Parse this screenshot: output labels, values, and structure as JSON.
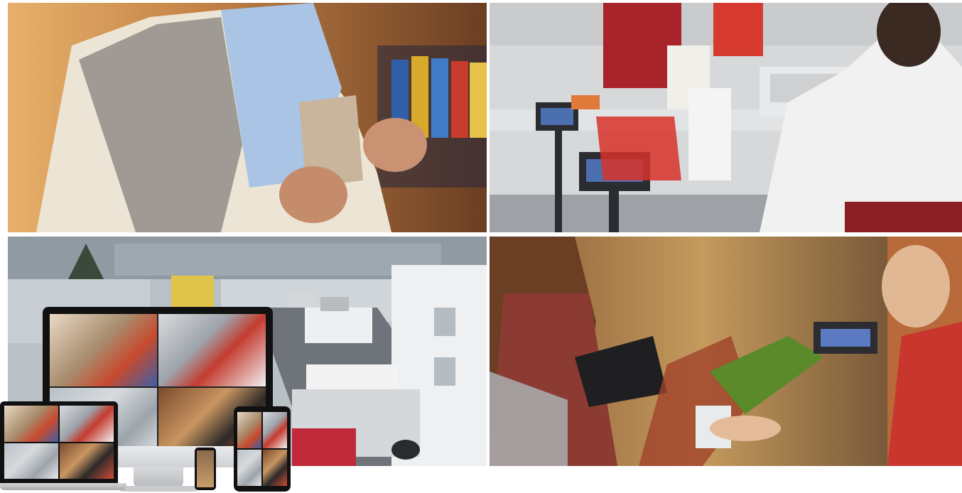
{
  "images": [
    {
      "key": "shoplifting",
      "icon": "shoplifter-photo",
      "colors": {
        "bg": "#c38a4b",
        "accent": "#bf7a3a"
      }
    },
    {
      "key": "checkout",
      "icon": "checkout-counter-photo",
      "colors": {
        "bg": "#d9dbdd",
        "accent": "#c23a2d"
      }
    },
    {
      "key": "parking",
      "icon": "parking-lot-surveillance-photo",
      "colors": {
        "bg": "#aeb5bb",
        "accent": "#eef0f1"
      }
    },
    {
      "key": "cashier",
      "icon": "cashier-payment-photo",
      "colors": {
        "bg": "#b27845",
        "accent": "#d6492f"
      }
    }
  ],
  "devices": [
    "monitor-icon",
    "laptop-icon",
    "phone-icon",
    "tablet-icon"
  ]
}
